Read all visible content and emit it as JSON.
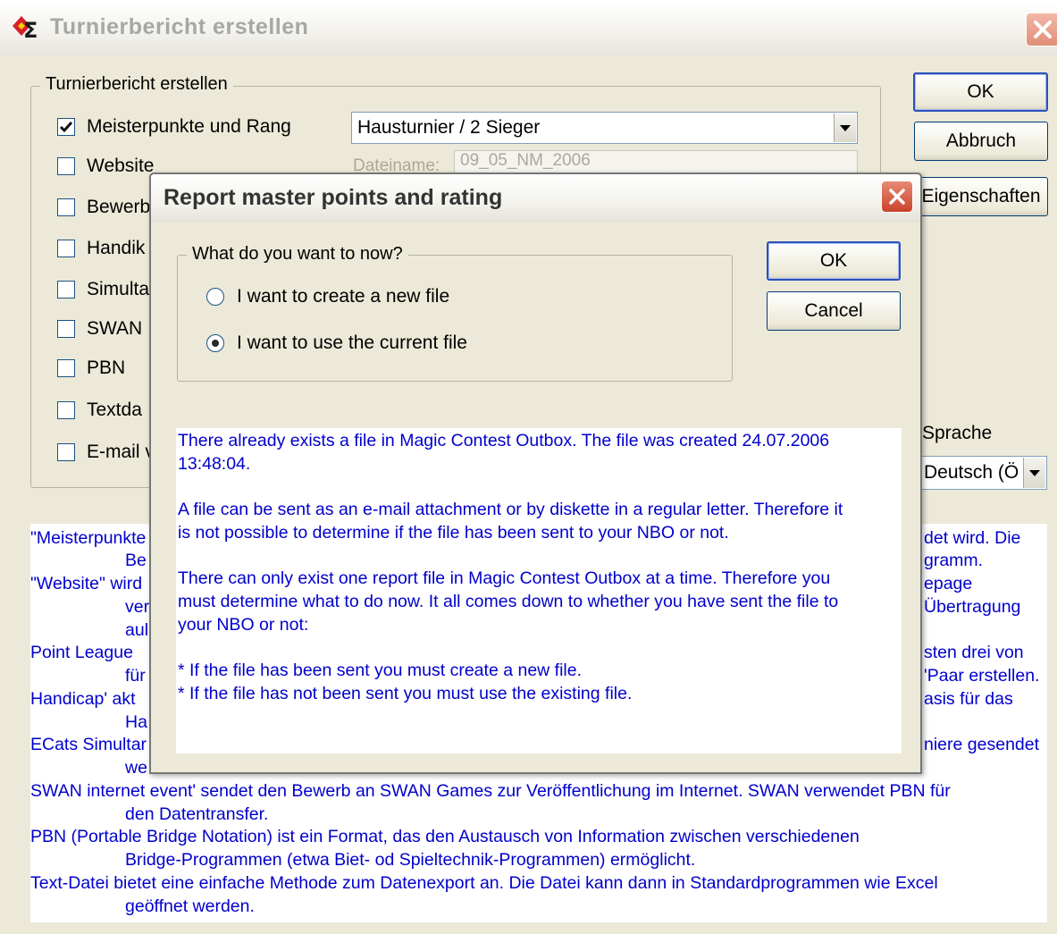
{
  "window": {
    "title": "Turnierbericht erstellen"
  },
  "group": {
    "legend": "Turnierbericht erstellen",
    "options": [
      {
        "label": "Meisterpunkte und Rang",
        "checked": true
      },
      {
        "label": "Website",
        "checked": false
      },
      {
        "label": "Bewerb",
        "checked": false
      },
      {
        "label": "Handik",
        "checked": false
      },
      {
        "label": "Simulta",
        "checked": false
      },
      {
        "label": "SWAN",
        "checked": false
      },
      {
        "label": "PBN",
        "checked": false
      },
      {
        "label": "Textda",
        "checked": false
      },
      {
        "label": "E-mail v",
        "checked": false
      }
    ],
    "tournament_type": "Hausturnier / 2 Sieger",
    "filename_label": "Dateiname:",
    "filename_value": "09_05_NM_2006"
  },
  "buttons": {
    "ok": "OK",
    "cancel": "Abbruch",
    "properties": "Eigenschaften"
  },
  "language": {
    "label": "Sprache",
    "value": "Deutsch (Ö"
  },
  "info_lines": [
    "\"Meisterpunkte",
    "Be",
    "\"Website\" wird",
    "ver",
    "aul",
    "Point League",
    "für",
    "Handicap' akt",
    "Ha",
    "ECats Simultar",
    "we",
    "SWAN internet event' sendet den Bewerb an SWAN Games zur Veröffentlichung im Internet. SWAN verwendet PBN für",
    "den Datentransfer.",
    "PBN (Portable Bridge Notation) ist ein Format, das den Austausch von Information zwischen verschiedenen",
    "Bridge-Programmen (etwa Biet- od Spieltechnik-Programmen) ermöglicht.",
    "Text-Datei bietet eine einfache Methode zum Datenexport an. Die Datei kann dann in Standardprogrammen wie Excel",
    "geöffnet werden."
  ],
  "info_right_lines": [
    "det wird. Die",
    "gramm.",
    "epage",
    "Übertragung",
    "sten drei von",
    "'Paar erstellen.",
    "asis für das",
    "niere gesendet"
  ],
  "modal": {
    "title": "Report master points and rating",
    "group_legend": "What do you want to now?",
    "options": [
      {
        "label": "I want to create a new file",
        "selected": false
      },
      {
        "label": "I want to use the current file",
        "selected": true
      }
    ],
    "ok": "OK",
    "cancel": "Cancel",
    "message_lines": [
      "There already exists a file in Magic Contest Outbox. The file was created 24.07.2006",
      "13:48:04.",
      "",
      "A file can be sent as an e-mail attachment or by diskette in a regular letter. Therefore it",
      "is not possible to determine if the file has been sent to your NBO or not.",
      "",
      "There can only exist one report file in Magic Contest Outbox at a time. Therefore you",
      "must determine what to do now. It all comes down to whether you have sent the file to",
      "your NBO or not:",
      "",
      "* If the file has been sent you must create a new file.",
      "* If the file has not been sent you must use the existing file."
    ]
  }
}
